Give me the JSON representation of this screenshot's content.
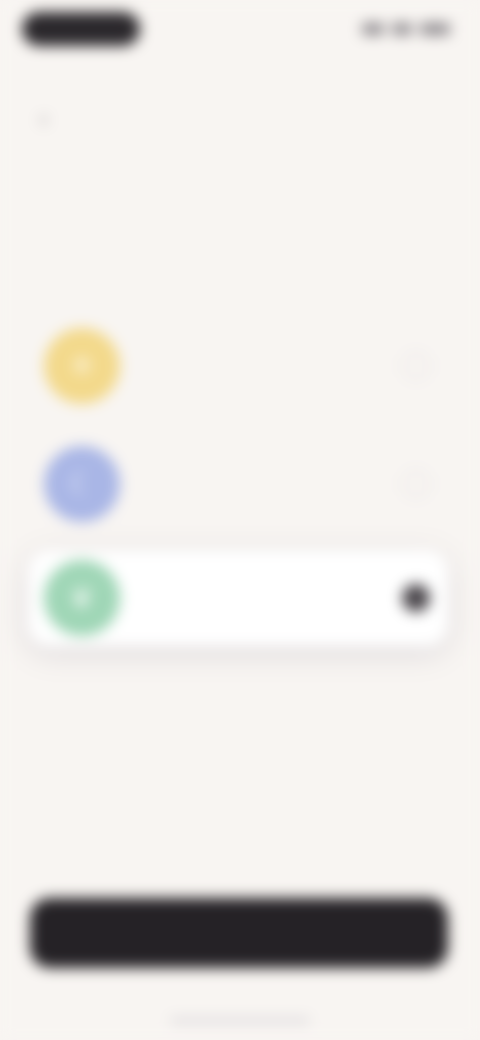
{
  "status_bar": {
    "time": "",
    "indicators": [
      "signal-icon",
      "wifi-icon",
      "battery-icon"
    ]
  },
  "nav": {
    "back_icon": "chevron-left-icon",
    "title": "",
    "skip_label": ""
  },
  "heading": {
    "title": "",
    "subtitle": ""
  },
  "options": [
    {
      "title": "",
      "description": "",
      "icon": "sun-icon",
      "color": "#f3d98b",
      "selected": false
    },
    {
      "title": "",
      "description": "",
      "icon": "moon-icon",
      "color": "#a9b6e6",
      "selected": false
    },
    {
      "title": "",
      "description": "",
      "icon": "leaf-icon",
      "color": "#9fd6b6",
      "selected": true
    }
  ],
  "cta": {
    "label": ""
  },
  "colors": {
    "background": "#f8f5f2",
    "primary": "#252226",
    "accent_yellow": "#f3d98b",
    "accent_blue": "#a9b6e6",
    "accent_green": "#9fd6b6"
  }
}
